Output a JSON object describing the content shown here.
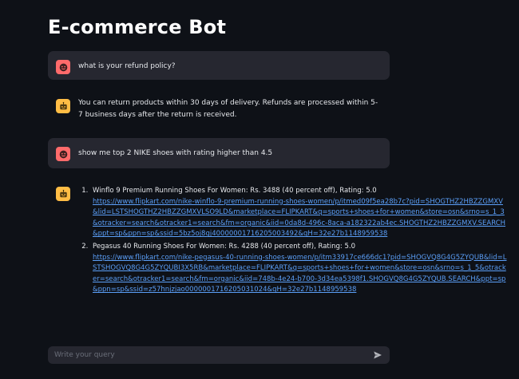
{
  "app": {
    "title": "E-commerce Bot"
  },
  "messages": [
    {
      "role": "user",
      "text": "what is your refund policy?"
    },
    {
      "role": "assistant",
      "text": "You can return products within 30 days of delivery. Refunds are processed within 5-7 business days after the return is received."
    },
    {
      "role": "user",
      "text": "show me top 2 NIKE shoes with rating higher than 4.5"
    },
    {
      "role": "assistant",
      "results": [
        {
          "title": "Winflo 9 Premium Running Shoes For Women: Rs. 3488 (40 percent off), Rating: 5.0",
          "link": "https://www.flipkart.com/nike-winflo-9-premium-running-shoes-women/p/itmed09f5ea28b7c?pid=SHOGTHZ2HBZZGMXV&lid=LSTSHOGTHZ2HBZZGMXVLSO9LD&marketplace=FLIPKART&q=sports+shoes+for+women&store=osn&srno=s_1_3&otracker=search&otracker1=search&fm=organic&iid=0da8d-496c-8aca-a182322ab4ec.SHOGTHZ2HBZZGMXV.SEARCH&ppt=sp&ppn=sp&ssid=5bz5oj8gj40000001716205003492&qH=32e27b1148959538"
        },
        {
          "title": "Pegasus 40 Running Shoes For Women: Rs. 4288 (40 percent off), Rating: 5.0",
          "link": "https://www.flipkart.com/nike-pegasus-40-running-shoes-women/p/itm33917ce666dc1?pid=SHOGVQ8G4G5ZYQUB&lid=LSTSHOGVQ8G4G5ZYQUBI3X5RB&marketplace=FLIPKART&q=sports+shoes+for+women&store=osn&srno=s_1_5&otracker=search&otracker1=search&fm=organic&iid=748b-4e24-b700-3d34ea5398f1.SHOGVQ8G4G5ZYQUB.SEARCH&ppt=sp&ppn=sp&ssid=z57hnjzjao0000001716205031024&qH=32e27b1148959538"
        }
      ]
    }
  ],
  "chat_input": {
    "placeholder": "Write your query",
    "value": ""
  },
  "icons": {
    "user_avatar": "smiley-face-icon",
    "bot_avatar": "robot-face-icon",
    "send": "send-arrow-icon"
  },
  "colors": {
    "background": "#0e1117",
    "user_bubble": "#262730",
    "user_avatar": "#ff6b6b",
    "bot_avatar": "#ffbd45",
    "link": "#5b9ff8"
  }
}
